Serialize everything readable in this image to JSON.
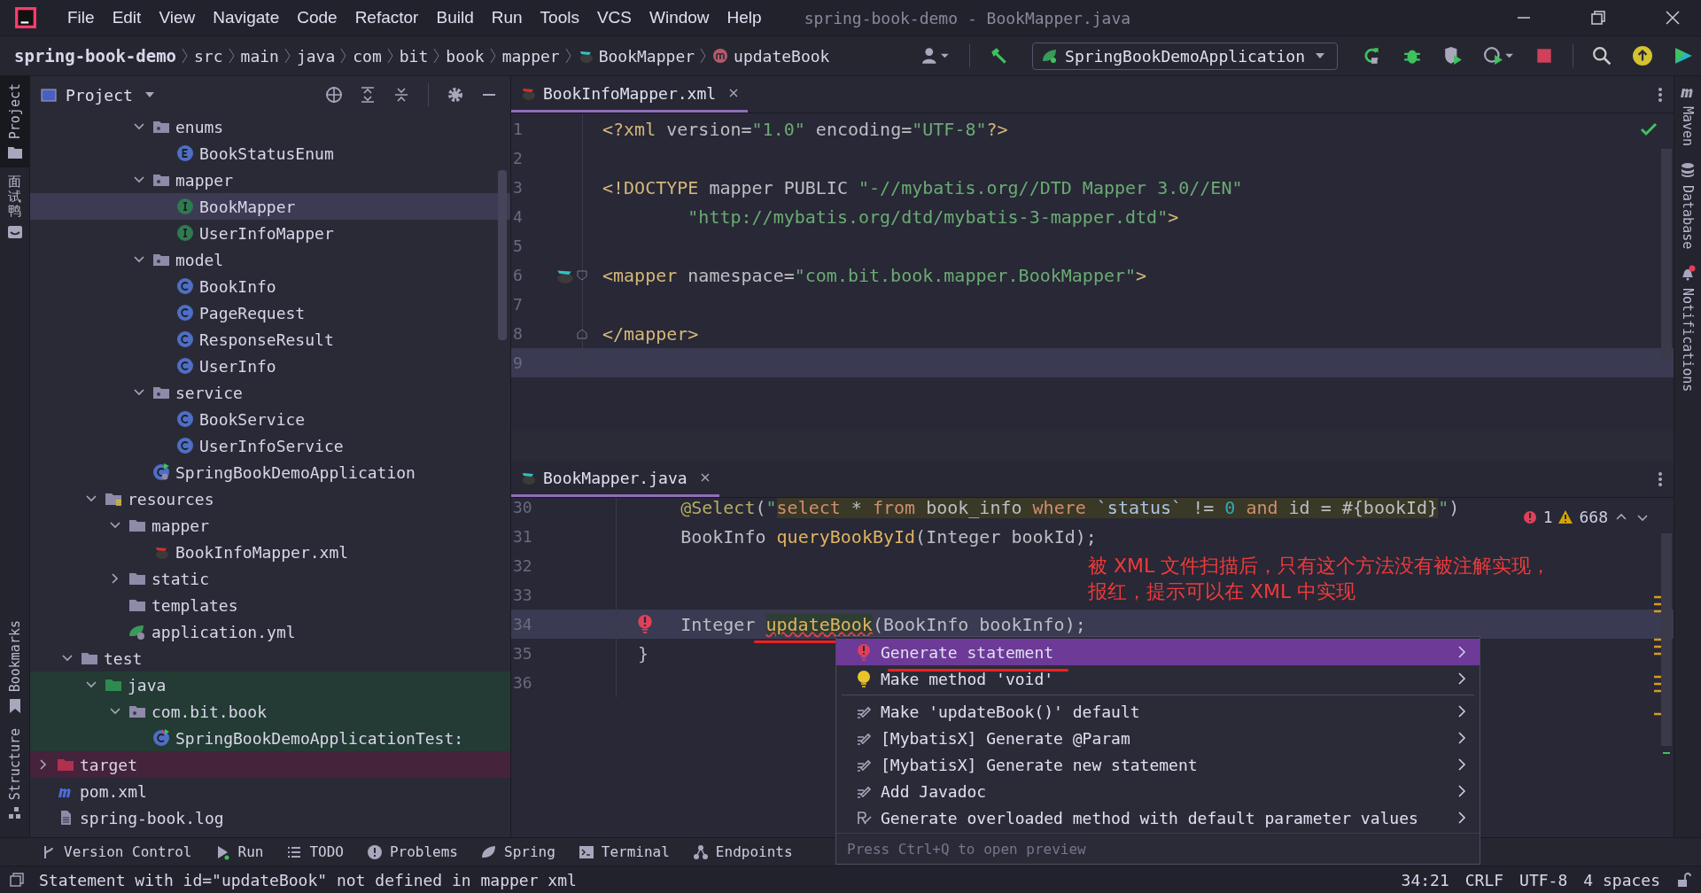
{
  "window": {
    "title": "spring-book-demo - BookMapper.java"
  },
  "menu": [
    "File",
    "Edit",
    "View",
    "Navigate",
    "Code",
    "Refactor",
    "Build",
    "Run",
    "Tools",
    "VCS",
    "Window",
    "Help"
  ],
  "breadcrumbs": [
    {
      "label": "spring-book-demo",
      "kind": "project"
    },
    {
      "label": "src",
      "kind": "dir"
    },
    {
      "label": "main",
      "kind": "dir"
    },
    {
      "label": "java",
      "kind": "dir"
    },
    {
      "label": "com",
      "kind": "dir"
    },
    {
      "label": "bit",
      "kind": "dir"
    },
    {
      "label": "book",
      "kind": "dir"
    },
    {
      "label": "mapper",
      "kind": "dir"
    },
    {
      "label": "BookMapper",
      "kind": "mapper"
    },
    {
      "label": "updateBook",
      "kind": "method"
    }
  ],
  "run_configuration": {
    "label": "SpringBookDemoApplication"
  },
  "left_stripe": [
    {
      "label": "Project",
      "kind": "project",
      "selected": true
    },
    {
      "label": "面试鸭",
      "kind": "plugin",
      "selected": false
    },
    {
      "label": "Bookmarks",
      "kind": "bookmarks",
      "selected": false
    },
    {
      "label": "Structure",
      "kind": "structure",
      "selected": false
    }
  ],
  "right_stripe": [
    {
      "label": "Maven",
      "kind": "maven"
    },
    {
      "label": "Database",
      "kind": "database"
    },
    {
      "label": "Notifications",
      "kind": "notifications"
    }
  ],
  "project_panel": {
    "title": "Project",
    "tree": [
      {
        "children": [
          {
            "children": [
              {
                "children": [
                  {
                    "children": [
                      {
                        "label": "enums",
                        "kind": "package",
                        "expanded": true,
                        "selected": false,
                        "children": [
                          {
                            "label": "BookStatusEnum",
                            "kind": "enum",
                            "selected": false
                          }
                        ]
                      },
                      {
                        "label": "mapper",
                        "kind": "package",
                        "expanded": true,
                        "selected": false,
                        "children": [
                          {
                            "label": "BookMapper",
                            "kind": "interface",
                            "selected": true
                          },
                          {
                            "label": "UserInfoMapper",
                            "kind": "interface",
                            "selected": false
                          }
                        ]
                      },
                      {
                        "label": "model",
                        "kind": "package",
                        "expanded": true,
                        "selected": false,
                        "children": [
                          {
                            "label": "BookInfo",
                            "kind": "class",
                            "selected": false
                          },
                          {
                            "label": "PageRequest",
                            "kind": "class",
                            "selected": false
                          },
                          {
                            "label": "ResponseResult",
                            "kind": "class",
                            "selected": false
                          },
                          {
                            "label": "UserInfo",
                            "kind": "class",
                            "selected": false
                          }
                        ]
                      },
                      {
                        "label": "service",
                        "kind": "package",
                        "expanded": true,
                        "selected": false,
                        "children": [
                          {
                            "label": "BookService",
                            "kind": "class",
                            "selected": false
                          },
                          {
                            "label": "UserInfoService",
                            "kind": "class",
                            "selected": false
                          }
                        ]
                      },
                      {
                        "label": "SpringBookDemoApplication",
                        "kind": "spring-class",
                        "selected": false
                      }
                    ]
                  }
                ]
              },
              {
                "label": "resources",
                "kind": "resources-folder",
                "expanded": true,
                "selected": false,
                "children": [
                  {
                    "label": "mapper",
                    "kind": "folder",
                    "expanded": true,
                    "selected": false,
                    "children": [
                      {
                        "label": "BookInfoMapper.xml",
                        "kind": "mybatis-xml",
                        "selected": false
                      }
                    ]
                  },
                  {
                    "label": "static",
                    "kind": "folder",
                    "expanded": false,
                    "selected": false
                  },
                  {
                    "label": "templates",
                    "kind": "folder",
                    "selected": false
                  },
                  {
                    "label": "application.yml",
                    "kind": "spring-yml",
                    "selected": false
                  }
                ]
              }
            ]
          },
          {
            "label": "test",
            "kind": "folder",
            "expanded": true,
            "selected": false,
            "children": [
              {
                "label": "java",
                "kind": "test-folder",
                "expanded": true,
                "selected": false,
                "children": [
                  {
                    "label": "com.bit.book",
                    "kind": "package",
                    "expanded": true,
                    "selected": false,
                    "children": [
                      {
                        "label": "SpringBookDemoApplicationTest:",
                        "kind": "test-class",
                        "selected": false
                      }
                    ]
                  }
                ]
              }
            ]
          }
        ]
      },
      {
        "label": "target",
        "kind": "excluded-folder",
        "expanded": false,
        "selected": false
      },
      {
        "label": "pom.xml",
        "kind": "maven",
        "selected": false
      },
      {
        "label": "spring-book.log",
        "kind": "log",
        "selected": false
      }
    ]
  },
  "editors": [
    {
      "tab": {
        "label": "BookInfoMapper.xml",
        "kind": "xml"
      },
      "inspection_passed": true,
      "lines": [
        {
          "number": "1",
          "current": false,
          "tokens": [
            {
              "text": "<?xml ",
              "kind": "tag"
            },
            {
              "text": "version=",
              "kind": "attr"
            },
            {
              "text": "\"1.0\"",
              "kind": "value"
            },
            {
              "text": " encoding=",
              "kind": "attr"
            },
            {
              "text": "\"UTF-8\"",
              "kind": "value"
            },
            {
              "text": "?>",
              "kind": "tag"
            }
          ]
        },
        {
          "number": "2",
          "current": false
        },
        {
          "number": "3",
          "current": false,
          "tokens": [
            {
              "text": "<!DOCTYPE ",
              "kind": "tag"
            },
            {
              "text": "mapper PUBLIC ",
              "kind": "attr"
            },
            {
              "text": "\"-//mybatis.org//DTD Mapper 3.0//EN\"",
              "kind": "value"
            }
          ]
        },
        {
          "number": "4",
          "current": false,
          "tokens": [
            {
              "text": "        \"http://mybatis.org/dtd/mybatis-3-mapper.dtd\"",
              "kind": "value"
            },
            {
              "text": ">",
              "kind": "tag"
            }
          ]
        },
        {
          "number": "5",
          "current": false
        },
        {
          "number": "6",
          "current": false,
          "marker": {
            "kind": "bird"
          },
          "fold": {
            "kind": "start"
          },
          "tokens": [
            {
              "text": "<mapper ",
              "kind": "tag"
            },
            {
              "text": "namespace=",
              "kind": "attr"
            },
            {
              "text": "\"com.bit.book.mapper.BookMapper\"",
              "kind": "value"
            },
            {
              "text": ">",
              "kind": "tag"
            }
          ]
        },
        {
          "number": "7",
          "current": false
        },
        {
          "number": "8",
          "current": false,
          "fold": {
            "kind": "end"
          },
          "tokens": [
            {
              "text": "</mapper>",
              "kind": "tag"
            }
          ]
        },
        {
          "number": "9",
          "current": true
        }
      ]
    },
    {
      "tab": {
        "label": "BookMapper.java",
        "kind": "mapper"
      },
      "inspections": {
        "errors": "1",
        "warnings": "668"
      },
      "lines": [
        {
          "number": "30",
          "current": false,
          "tokens": [
            {
              "text": "    @Select",
              "kind": "annotation"
            },
            {
              "text": "(",
              "kind": "plain"
            },
            {
              "text": "\"",
              "kind": "string"
            },
            {
              "text": "select",
              "kind": "sql-keyword"
            },
            {
              "text": " * ",
              "kind": "sql"
            },
            {
              "text": "from",
              "kind": "sql-keyword"
            },
            {
              "text": " book_info ",
              "kind": "sql"
            },
            {
              "text": "where",
              "kind": "sql-keyword"
            },
            {
              "text": " `status`",
              "kind": "sql-ident"
            },
            {
              "text": " != ",
              "kind": "sql"
            },
            {
              "text": "0 ",
              "kind": "sql-number"
            },
            {
              "text": "and",
              "kind": "sql-keyword"
            },
            {
              "text": " id = #{bookId}",
              "kind": "sql"
            },
            {
              "text": "\"",
              "kind": "string"
            },
            {
              "text": ")",
              "kind": "plain"
            }
          ]
        },
        {
          "number": "31",
          "current": false,
          "tokens": [
            {
              "text": "    BookInfo ",
              "kind": "plain"
            },
            {
              "text": "queryBookById",
              "kind": "method"
            },
            {
              "text": "(Integer bookId);",
              "kind": "plain"
            }
          ]
        },
        {
          "number": "32",
          "current": false
        },
        {
          "number": "33",
          "current": false
        },
        {
          "number": "34",
          "current": true,
          "marker": {
            "kind": "error-bulb"
          },
          "tokens": [
            {
              "text": "    Integer ",
              "kind": "plain"
            },
            {
              "text": "updateBook",
              "kind": "method-error"
            },
            {
              "text": "(BookInfo bookInfo);",
              "kind": "plain"
            }
          ]
        },
        {
          "number": "35",
          "current": false,
          "tokens": [
            {
              "text": "}",
              "kind": "plain"
            }
          ]
        },
        {
          "number": "36",
          "current": false
        }
      ]
    }
  ],
  "popup": {
    "items": [
      {
        "label": "Generate statement",
        "kind": "error",
        "selected": true
      },
      {
        "label": "Make method 'void'",
        "kind": "bulb",
        "selected": false
      },
      {
        "kind": "separator"
      },
      {
        "label": "Make 'updateBook()' default",
        "kind": "edit",
        "selected": false
      },
      {
        "label": "[MybatisX] Generate @Param",
        "kind": "edit",
        "selected": false
      },
      {
        "label": "[MybatisX] Generate new statement",
        "kind": "edit",
        "selected": false
      },
      {
        "label": "Add Javadoc",
        "kind": "edit",
        "selected": false
      },
      {
        "label": "Generate overloaded method with default parameter values",
        "kind": "refactor",
        "selected": false
      }
    ],
    "footer": "Press Ctrl+Q to open preview"
  },
  "annotation": {
    "lines": [
      "被 XML 文件扫描后，只有这个方法没有被注解实现，",
      "报红，提示可以在 XML 中实现"
    ]
  },
  "tool_windows": [
    {
      "label": "Version Control",
      "kind": "vcs"
    },
    {
      "label": "Run",
      "kind": "run"
    },
    {
      "label": "TODO",
      "kind": "todo"
    },
    {
      "label": "Problems",
      "kind": "problems"
    },
    {
      "label": "Spring",
      "kind": "spring"
    },
    {
      "label": "Terminal",
      "kind": "terminal"
    },
    {
      "label": "Endpoints",
      "kind": "endpoints"
    }
  ],
  "status_bar": {
    "message": "Statement with id=\"updateBook\" not defined in mapper xml",
    "items": [
      "34:21",
      "CRLF",
      "UTF-8",
      "4 spaces"
    ]
  }
}
